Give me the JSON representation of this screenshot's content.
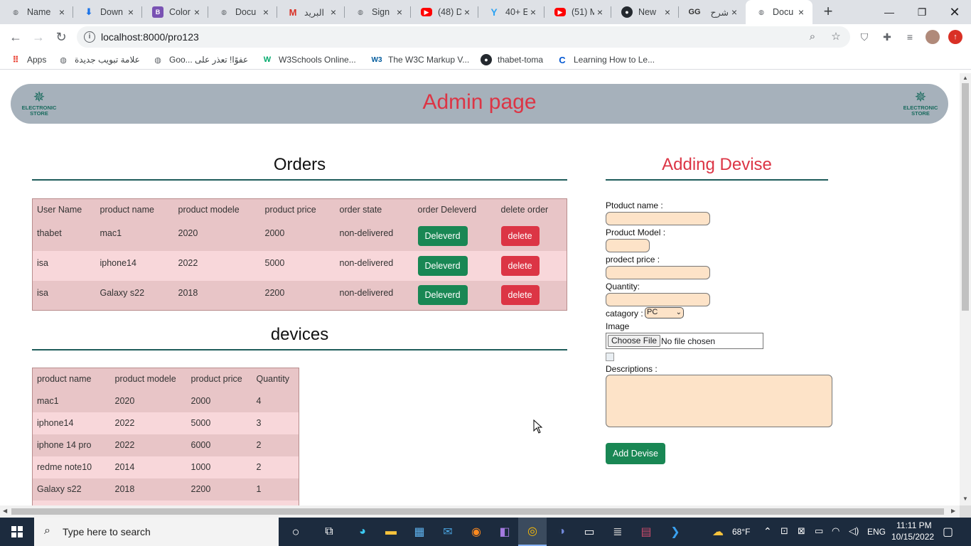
{
  "browser": {
    "tabs": [
      {
        "label": "Name",
        "icon": "globe",
        "color": "#5f6368"
      },
      {
        "label": "Down",
        "icon": "download",
        "color": "#1a73e8"
      },
      {
        "label": "Color",
        "icon": "bootstrap",
        "color": "#7952b3"
      },
      {
        "label": "Docu",
        "icon": "globe",
        "color": "#5f6368"
      },
      {
        "label": "البريد",
        "icon": "gmail",
        "color": "#d93025"
      },
      {
        "label": "Sign",
        "icon": "globe",
        "color": "#5f6368"
      },
      {
        "label": "(48) D",
        "icon": "youtube",
        "color": "#ff0000"
      },
      {
        "label": "40+ E",
        "icon": "y",
        "color": "#2ea3f2"
      },
      {
        "label": "(51) M",
        "icon": "youtube",
        "color": "#ff0000"
      },
      {
        "label": "New",
        "icon": "github",
        "color": "#24292f"
      },
      {
        "label": "شرح",
        "icon": "gg",
        "color": "#333333"
      },
      {
        "label": "Docu",
        "icon": "globe",
        "color": "#5f6368"
      }
    ],
    "url": "localhost:8000/pro123",
    "bookmarks": [
      {
        "label": "Apps",
        "icon": "apps"
      },
      {
        "label": "علامة تبويب جديدة",
        "icon": "globe"
      },
      {
        "label": "Goo... عفوًا! تعذر على",
        "icon": "globe"
      },
      {
        "label": "W3Schools Online...",
        "icon": "w3schools"
      },
      {
        "label": "The W3C Markup V...",
        "icon": "w3c"
      },
      {
        "label": "thabet-toma",
        "icon": "github"
      },
      {
        "label": "Learning How to Le...",
        "icon": "coursera"
      }
    ]
  },
  "page": {
    "title": "Admin page",
    "logo_text": "ELECTRONIC STORE",
    "orders": {
      "title": "Orders",
      "headers": [
        "User Name",
        "product name",
        "product modele",
        "product price",
        "order state",
        "order Deleverd",
        "delete order"
      ],
      "rows": [
        {
          "user": "thabet",
          "product": "mac1",
          "model": "2020",
          "price": "2000",
          "state": "non-delivered"
        },
        {
          "user": "isa",
          "product": "iphone14",
          "model": "2022",
          "price": "5000",
          "state": "non-delivered"
        },
        {
          "user": "isa",
          "product": "Galaxy s22",
          "model": "2018",
          "price": "2200",
          "state": "non-delivered"
        }
      ],
      "deliver_label": "Deleverd",
      "delete_label": "delete"
    },
    "devices": {
      "title": "devices",
      "headers": [
        "product name",
        "product modele",
        "product price",
        "Quantity"
      ],
      "rows": [
        {
          "name": "mac1",
          "model": "2020",
          "price": "2000",
          "qty": "4"
        },
        {
          "name": "iphone14",
          "model": "2022",
          "price": "5000",
          "qty": "3"
        },
        {
          "name": "iphone 14 pro",
          "model": "2022",
          "price": "6000",
          "qty": "2"
        },
        {
          "name": "redme note10",
          "model": "2014",
          "price": "1000",
          "qty": "2"
        },
        {
          "name": "Galaxy s22",
          "model": "2018",
          "price": "2200",
          "qty": "1"
        }
      ]
    },
    "form": {
      "title": "Adding Devise",
      "product_name_label": "Ptoduct name :",
      "product_model_label": "Product Model :",
      "price_label": "prodect price :",
      "quantity_label": "Quantity:",
      "category_label": "catagory :",
      "category_value": "PC",
      "image_label": "Image",
      "file_button": "Choose File",
      "file_status": "No file chosen",
      "descriptions_label": "Descriptions :",
      "submit_label": "Add Devise"
    }
  },
  "taskbar": {
    "search_placeholder": "Type here to search",
    "weather": "68°F",
    "language": "ENG",
    "time": "11:11 PM",
    "date": "10/15/2022"
  },
  "colors": {
    "accent_red": "#dc3545",
    "accent_green": "#198754",
    "header_bar": "#a6b1bb",
    "row_odd": "#e8c5c7",
    "row_even": "#f8d7da",
    "input_bg": "#fde3c8"
  }
}
